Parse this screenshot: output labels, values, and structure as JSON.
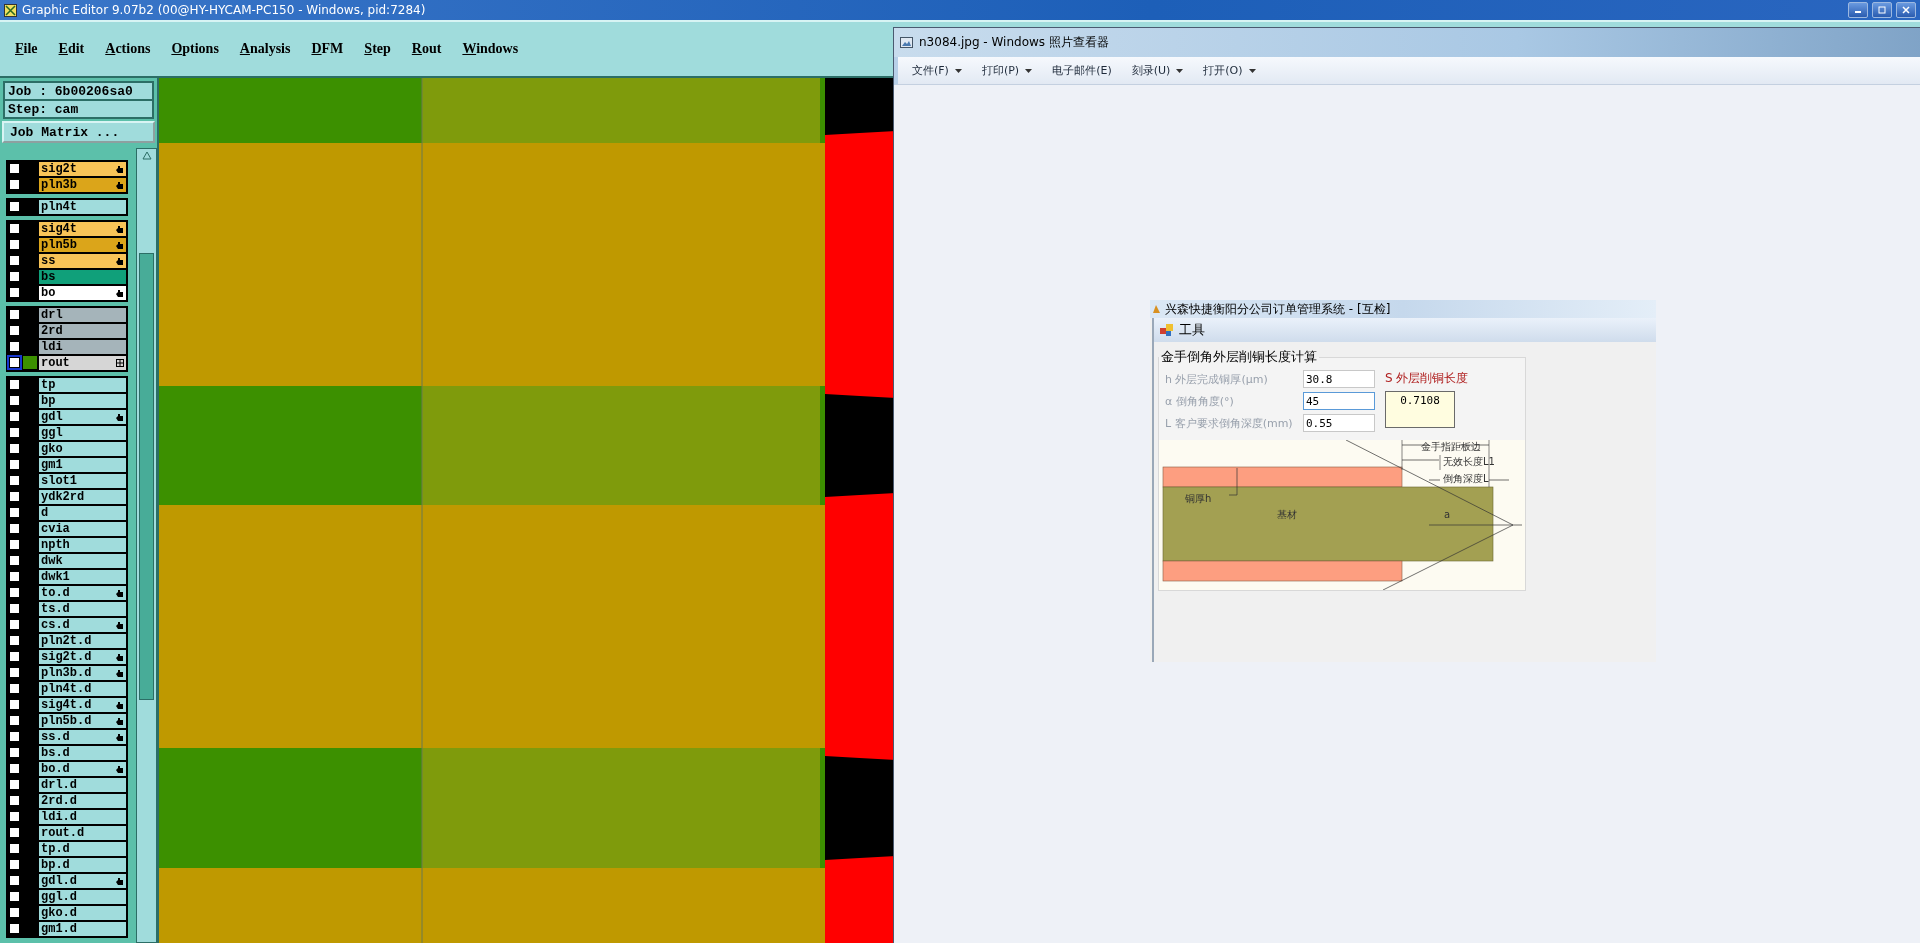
{
  "app": {
    "title": "Graphic Editor 9.07b2 (00@HY-HYCAM-PC150 - Windows, pid:7284)",
    "menu": [
      "File",
      "Edit",
      "Actions",
      "Options",
      "Analysis",
      "DFM",
      "Step",
      "Rout",
      "Windows"
    ]
  },
  "job": {
    "job_label": "Job : 6b00206sa0",
    "step_label": "Step: cam",
    "matrix_button": "Job Matrix ..."
  },
  "layer_groups": [
    {
      "layers": [
        {
          "name": "sig2t",
          "color": "#f8c458",
          "affected": true,
          "work": false,
          "checked": false
        },
        {
          "name": "pln3b",
          "color": "#dba51a",
          "affected": true,
          "work": false,
          "checked": false
        }
      ]
    },
    {
      "layers": [
        {
          "name": "pln4t",
          "color": "#a0dcdc",
          "affected": false,
          "work": false,
          "checked": false
        }
      ]
    },
    {
      "layers": [
        {
          "name": "sig4t",
          "color": "#f8c458",
          "affected": true,
          "work": false,
          "checked": false
        },
        {
          "name": "pln5b",
          "color": "#dba51a",
          "affected": true,
          "work": false,
          "checked": false
        },
        {
          "name": "ss",
          "color": "#f8c458",
          "affected": true,
          "work": false,
          "checked": false
        },
        {
          "name": "bs",
          "color": "#10a07a",
          "affected": false,
          "work": false,
          "checked": false
        },
        {
          "name": "bo",
          "color": "#ffffff",
          "affected": true,
          "work": false,
          "checked": false
        }
      ]
    },
    {
      "layers": [
        {
          "name": "drl",
          "color": "#a5b4ba",
          "affected": false,
          "work": false,
          "checked": false
        },
        {
          "name": "2rd",
          "color": "#a5b4ba",
          "affected": false,
          "work": false,
          "checked": false
        },
        {
          "name": "ldi",
          "color": "#a5b4ba",
          "affected": false,
          "work": false,
          "checked": false
        },
        {
          "name": "rout",
          "color": "#d6d6d6",
          "affected": false,
          "work": true,
          "checked": false
        }
      ]
    },
    {
      "layers": [
        {
          "name": "tp",
          "color": "#a0dcdc",
          "affected": false,
          "work": false,
          "checked": false
        },
        {
          "name": "bp",
          "color": "#a0dcdc",
          "affected": false,
          "work": false,
          "checked": false
        },
        {
          "name": "gdl",
          "color": "#a0dcdc",
          "affected": true,
          "work": false,
          "checked": false
        },
        {
          "name": "ggl",
          "color": "#a0dcdc",
          "affected": false,
          "work": false,
          "checked": false
        },
        {
          "name": "gko",
          "color": "#a0dcdc",
          "affected": false,
          "work": false,
          "checked": false
        },
        {
          "name": "gm1",
          "color": "#a0dcdc",
          "affected": false,
          "work": false,
          "checked": false
        },
        {
          "name": "slot1",
          "color": "#a0dcdc",
          "affected": false,
          "work": false,
          "checked": false
        },
        {
          "name": "ydk2rd",
          "color": "#a0dcdc",
          "affected": false,
          "work": false,
          "checked": false
        },
        {
          "name": "d",
          "color": "#a0dcdc",
          "affected": false,
          "work": false,
          "checked": false
        },
        {
          "name": "cvia",
          "color": "#a0dcdc",
          "affected": false,
          "work": false,
          "checked": false
        },
        {
          "name": "npth",
          "color": "#a0dcdc",
          "affected": false,
          "work": false,
          "checked": false
        },
        {
          "name": "dwk",
          "color": "#a0dcdc",
          "affected": false,
          "work": false,
          "checked": false
        },
        {
          "name": "dwk1",
          "color": "#a0dcdc",
          "affected": false,
          "work": false,
          "checked": false
        },
        {
          "name": "to.d",
          "color": "#a0dcdc",
          "affected": true,
          "work": false,
          "checked": false
        },
        {
          "name": "ts.d",
          "color": "#a0dcdc",
          "affected": false,
          "work": false,
          "checked": false
        },
        {
          "name": "cs.d",
          "color": "#a0dcdc",
          "affected": true,
          "work": false,
          "checked": false
        },
        {
          "name": "pln2t.d",
          "color": "#a0dcdc",
          "affected": false,
          "work": false,
          "checked": false
        },
        {
          "name": "sig2t.d",
          "color": "#a0dcdc",
          "affected": true,
          "work": false,
          "checked": false
        },
        {
          "name": "pln3b.d",
          "color": "#a0dcdc",
          "affected": true,
          "work": false,
          "checked": false
        },
        {
          "name": "pln4t.d",
          "color": "#a0dcdc",
          "affected": false,
          "work": false,
          "checked": false
        },
        {
          "name": "sig4t.d",
          "color": "#a0dcdc",
          "affected": true,
          "work": false,
          "checked": false
        },
        {
          "name": "pln5b.d",
          "color": "#a0dcdc",
          "affected": true,
          "work": false,
          "checked": false
        },
        {
          "name": "ss.d",
          "color": "#a0dcdc",
          "affected": true,
          "work": false,
          "checked": false
        },
        {
          "name": "bs.d",
          "color": "#a0dcdc",
          "affected": false,
          "work": false,
          "checked": false
        },
        {
          "name": "bo.d",
          "color": "#a0dcdc",
          "affected": true,
          "work": false,
          "checked": false
        },
        {
          "name": "drl.d",
          "color": "#a0dcdc",
          "affected": false,
          "work": false,
          "checked": false
        },
        {
          "name": "2rd.d",
          "color": "#a0dcdc",
          "affected": false,
          "work": false,
          "checked": false
        },
        {
          "name": "ldi.d",
          "color": "#a0dcdc",
          "affected": false,
          "work": false,
          "checked": false
        },
        {
          "name": "rout.d",
          "color": "#a0dcdc",
          "affected": false,
          "work": false,
          "checked": false
        },
        {
          "name": "tp.d",
          "color": "#a0dcdc",
          "affected": false,
          "work": false,
          "checked": false
        },
        {
          "name": "bp.d",
          "color": "#a0dcdc",
          "affected": false,
          "work": false,
          "checked": false
        },
        {
          "name": "gdl.d",
          "color": "#a0dcdc",
          "affected": true,
          "work": false,
          "checked": false
        },
        {
          "name": "ggl.d",
          "color": "#a0dcdc",
          "affected": false,
          "work": false,
          "checked": false
        },
        {
          "name": "gko.d",
          "color": "#a0dcdc",
          "affected": false,
          "work": false,
          "checked": false
        },
        {
          "name": "gm1.d",
          "color": "#a0dcdc",
          "affected": false,
          "work": false,
          "checked": false
        }
      ]
    }
  ],
  "viewer": {
    "title": "n3084.jpg - Windows 照片查看器",
    "menu": [
      {
        "label": "文件(F)",
        "dropdown": true
      },
      {
        "label": "打印(P)",
        "dropdown": true
      },
      {
        "label": "电子邮件(E)",
        "dropdown": false
      },
      {
        "label": "刻录(U)",
        "dropdown": true
      },
      {
        "label": "打开(O)",
        "dropdown": true
      }
    ],
    "image": {
      "title": "兴森快捷衡阳分公司订单管理系统 - [互检]",
      "tool_title": "工具",
      "group_title": "金手倒角外层削铜长度计算",
      "fields": [
        {
          "label": "h 外层完成铜厚(μm)",
          "value": "30.8",
          "focused": false
        },
        {
          "label": "α 倒角角度(°)",
          "value": "45",
          "focused": true
        },
        {
          "label": "L 客户要求倒角深度(mm)",
          "value": "0.55",
          "focused": false
        }
      ],
      "result": {
        "label": "S 外层削铜长度",
        "value": "0.7108"
      },
      "diagram": {
        "edge_distance": "金手指距板边",
        "invalid_length": "无效长度L1",
        "bevel_depth": "倒角深度L",
        "copper_thickness": "铜厚h",
        "substrate": "基材",
        "angle": "a"
      }
    }
  }
}
